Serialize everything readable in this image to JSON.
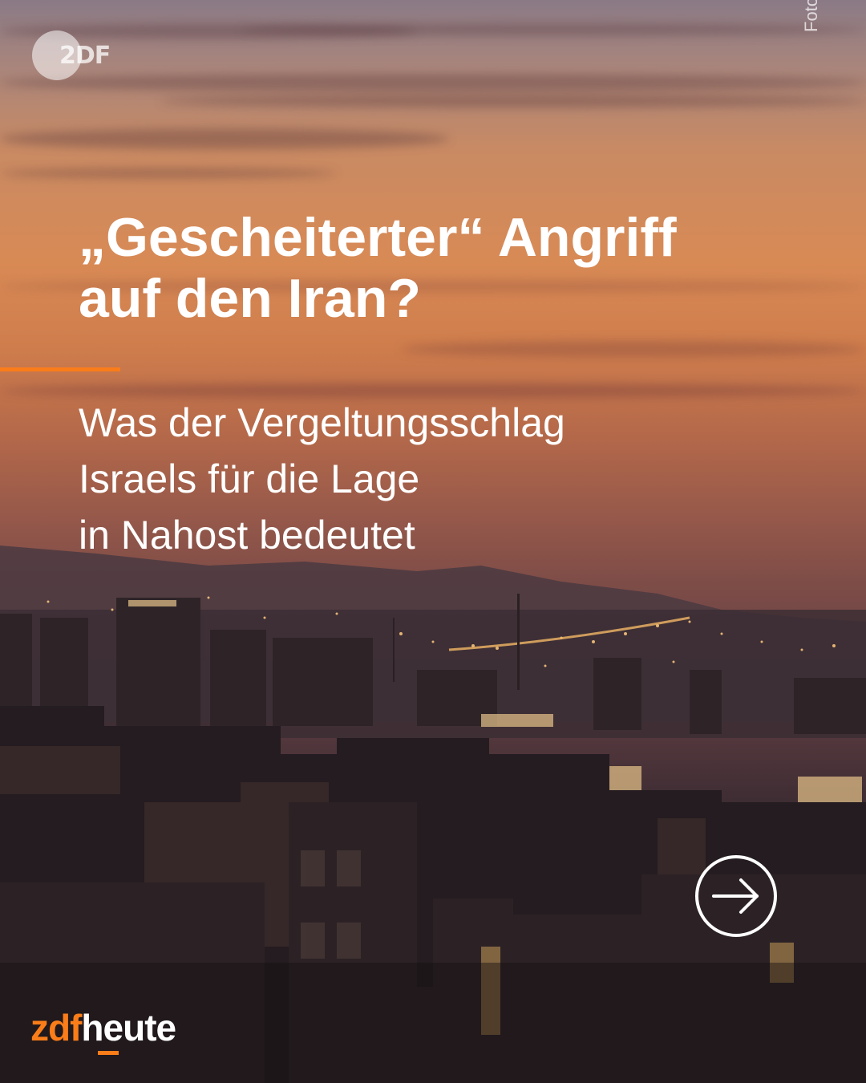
{
  "watermark": {
    "logo_text": "2DF",
    "icon": "zdf-logo-icon"
  },
  "photo_credit": "Foto: AFP/Atta Kenare",
  "headline": {
    "line1": "„Gescheiterter“ Angriff",
    "line2": "auf den Iran?"
  },
  "subline": {
    "line1": "Was der Vergeltungsschlag",
    "line2": "Israels für die Lage",
    "line3": "in Nahost bedeutet"
  },
  "next_button": {
    "icon": "arrow-right-circle-icon"
  },
  "brand": {
    "part1": "zdf",
    "part2": "heute"
  },
  "colors": {
    "accent": "#fa7d19",
    "text": "#ffffff"
  }
}
